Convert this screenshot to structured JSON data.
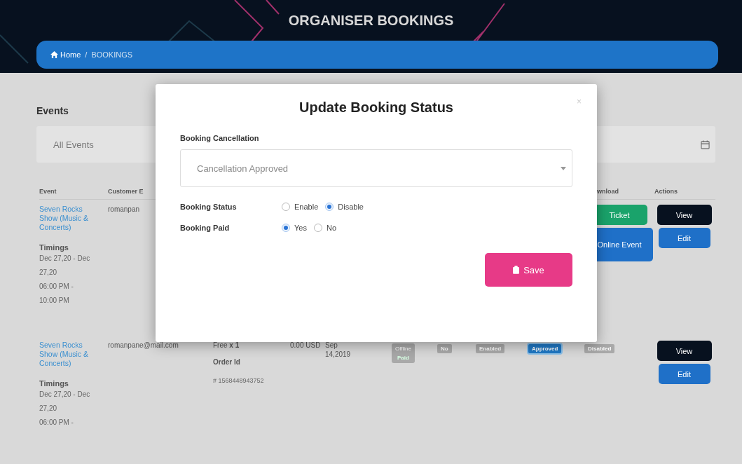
{
  "header": {
    "title": "ORGANISER BOOKINGS"
  },
  "breadcrumb": [
    {
      "label": "Home",
      "kind": "home"
    },
    {
      "label": "/",
      "kind": "separator"
    },
    {
      "label": "BOOKINGS",
      "kind": "current"
    }
  ],
  "filters": {
    "label": "Events",
    "event_select": {
      "value": "All Events"
    }
  },
  "table": {
    "columns": [
      {
        "label": "Event"
      },
      {
        "label": "Customer E"
      },
      {
        "label": "wnload"
      },
      {
        "label": "Actions"
      }
    ],
    "rows": [
      {
        "event": "Seven Rocks Show (Music & Concerts)",
        "timings_label": "Timings",
        "timings": [
          "Dec 27,20 - Dec 27,20",
          "06:00 PM - 10:00 PM"
        ],
        "email": "romanpan",
        "downloads": [
          {
            "label": "Ticket",
            "kind": "ticket"
          },
          {
            "label": "Online Event",
            "kind": "online"
          }
        ],
        "actions": [
          {
            "label": "View",
            "kind": "view"
          },
          {
            "label": "Edit",
            "kind": "edit"
          }
        ]
      },
      {
        "event": "Seven Rocks Show (Music & Concerts)",
        "timings_label": "Timings",
        "timings": [
          "Dec 27,20 - Dec 27,20",
          "06:00 PM -"
        ],
        "email": "romanpane@mail.com",
        "ticket": "Free **x 1**",
        "order_label": "Order Id",
        "order_id": "# 1568448943752",
        "price": "0.00 USD",
        "date": "Sep 14,2019",
        "payment": {
          "mode": "Offline",
          "paid": "Paid"
        },
        "badges": [
          {
            "label": "No",
            "kind": "muted"
          },
          {
            "label": "Enabled",
            "kind": "muted"
          },
          {
            "label": "Approved",
            "kind": "active"
          },
          {
            "label": "Disabled",
            "kind": "muted"
          }
        ],
        "actions": [
          {
            "label": "View",
            "kind": "view"
          },
          {
            "label": "Edit",
            "kind": "edit"
          }
        ]
      }
    ]
  },
  "modal": {
    "title": "Update Booking Status",
    "close": "×",
    "cancellation_label": "Booking Cancellation",
    "cancellation_value": "Cancellation Approved",
    "groups": [
      {
        "label": "Booking Status",
        "options": [
          {
            "label": "Enable",
            "checked": false
          },
          {
            "label": "Disable",
            "checked": true
          }
        ]
      },
      {
        "label": "Booking Paid",
        "options": [
          {
            "label": "Yes",
            "checked": true
          },
          {
            "label": "No",
            "checked": false
          }
        ]
      }
    ],
    "save": "Save"
  }
}
